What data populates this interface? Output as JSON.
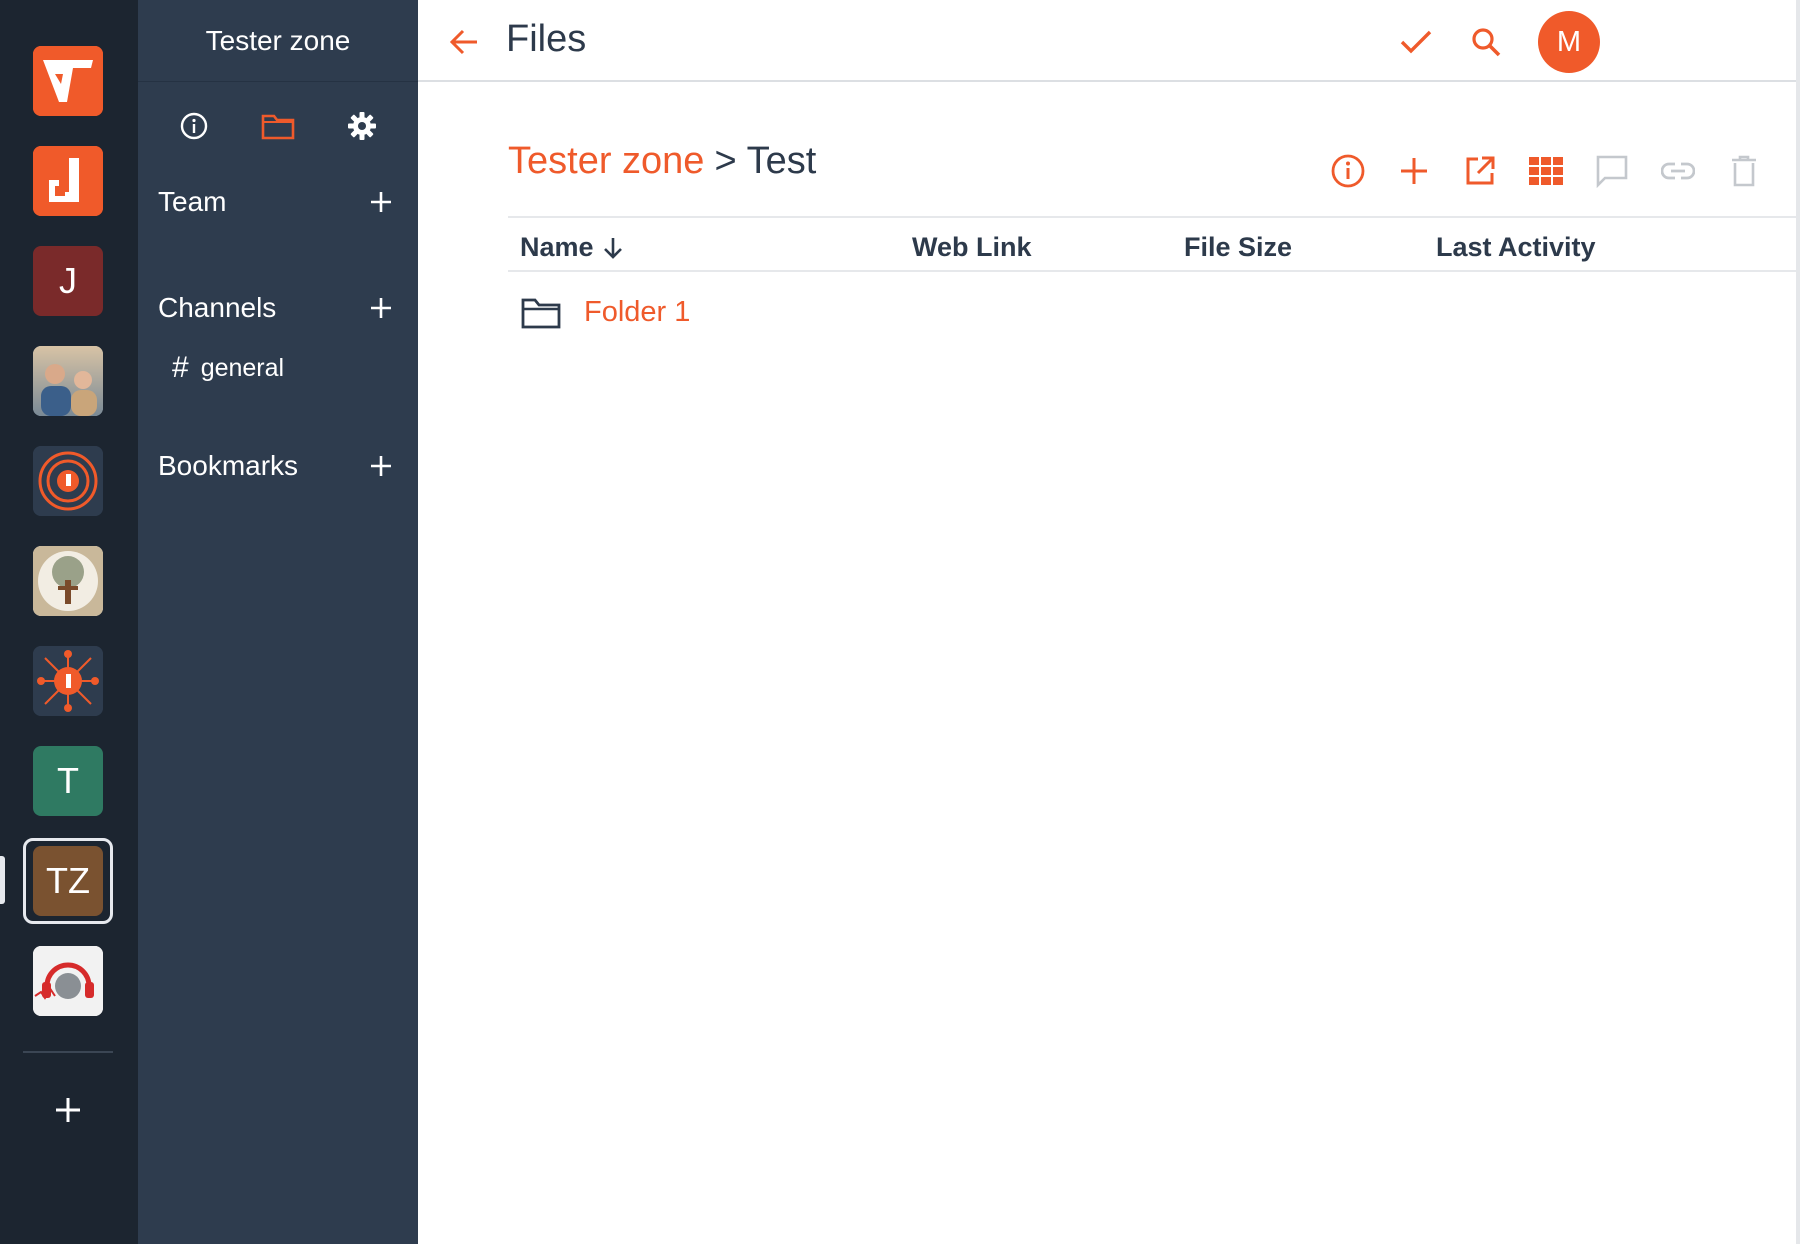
{
  "colors": {
    "accent": "#ef5a2b",
    "rail_bg": "#1c2530",
    "panel_bg": "#2e3c4e",
    "text_dark": "#2d3a4b"
  },
  "rail": {
    "teams": [
      {
        "kind": "logo",
        "icon": "app-logo-icon",
        "color": "#f05a2a"
      },
      {
        "kind": "logo",
        "icon": "d-logo-icon",
        "color": "#f05a2a"
      },
      {
        "kind": "letter",
        "label": "J",
        "color": "#7a2a2a"
      },
      {
        "kind": "photo",
        "icon": "people-photo",
        "color": "#8a9aa8"
      },
      {
        "kind": "logo",
        "icon": "circle-d-logo-icon",
        "color": "#2e3c4e"
      },
      {
        "kind": "logo",
        "icon": "tree-logo-icon",
        "color": "#efe6d6"
      },
      {
        "kind": "logo",
        "icon": "network-d-logo-icon",
        "color": "#2e3c4e"
      },
      {
        "kind": "letter",
        "label": "T",
        "color": "#2f7a62"
      },
      {
        "kind": "letter",
        "label": "TZ",
        "color": "#7a5230",
        "selected": true
      },
      {
        "kind": "logo",
        "icon": "headphones-globe-icon",
        "color": "#f2f2f2"
      }
    ],
    "add_icon": "plus-icon"
  },
  "side": {
    "team_name": "Tester zone",
    "tabs": [
      "info-icon",
      "folder-icon",
      "gear-icon"
    ],
    "team_label": "Team",
    "channels_label": "Channels",
    "channel_general": "general",
    "bookmarks_label": "Bookmarks"
  },
  "main": {
    "title": "Files",
    "avatar_initial": "M",
    "breadcrumb": {
      "root": "Tester zone",
      "separator": ">",
      "current": "Test"
    },
    "toolbar": [
      "info-icon",
      "plus-icon",
      "open-external-icon",
      "grid-view-icon",
      "comment-icon",
      "link-icon",
      "trash-icon"
    ],
    "columns": {
      "name": "Name",
      "web_link": "Web Link",
      "file_size": "File Size",
      "last_activity": "Last Activity"
    },
    "rows": [
      {
        "name": "Folder 1",
        "type": "folder"
      }
    ]
  }
}
